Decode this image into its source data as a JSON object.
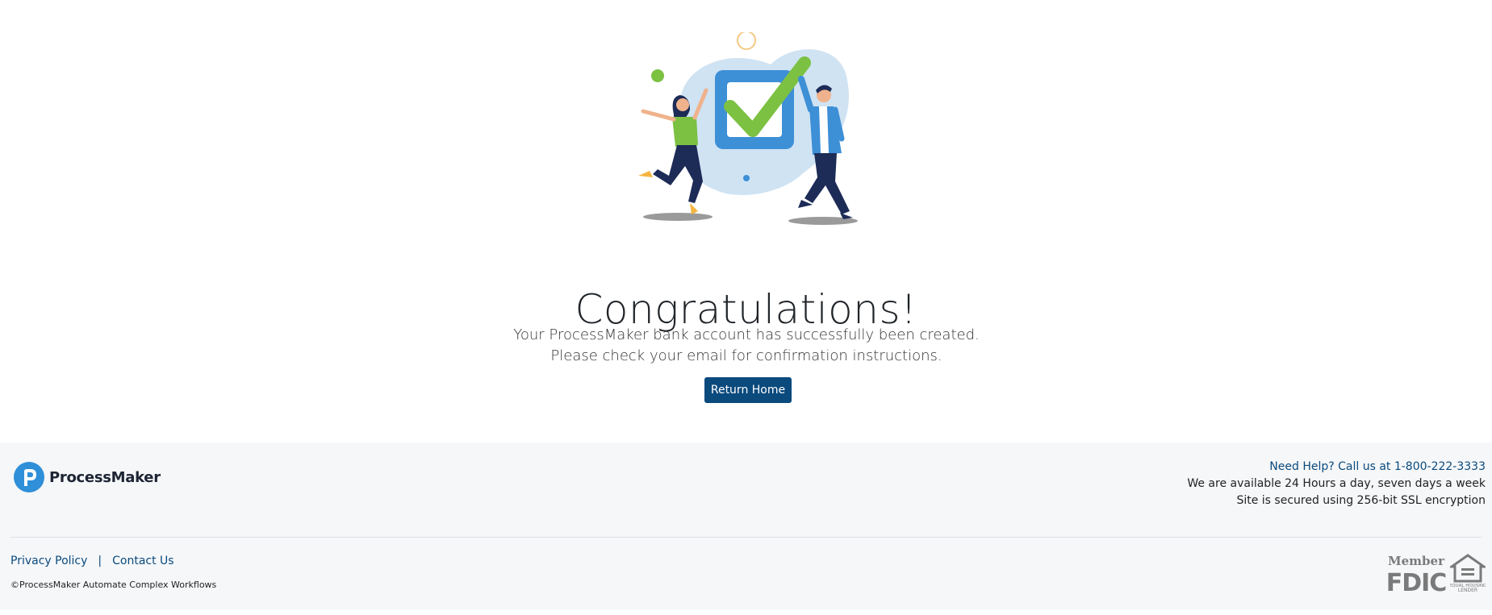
{
  "main": {
    "title": "Congratulations!",
    "message": "Your ProcessMaker bank account has successfully been created. Please check your email for confirmation instructions.",
    "return_button": "Return Home"
  },
  "footer": {
    "brand_name": "ProcessMaker",
    "help_line": "Need Help? Call us at 1-800-222-3333",
    "availability": "We are available 24 Hours a day, seven days a week",
    "security": "Site is secured using 256-bit SSL encryption",
    "links": {
      "privacy": "Privacy Policy",
      "separator": "|",
      "contact": "Contact Us"
    },
    "copyright": "©ProcessMaker Automate Complex Workflows",
    "badges": {
      "fdic_member": "Member",
      "fdic": "FDIC",
      "housing_line1": "EQUAL HOUSING",
      "housing_line2": "LENDER"
    }
  },
  "colors": {
    "primary": "#0b4a7d",
    "check_green": "#7cc142",
    "box_blue": "#3d8fd6",
    "blob": "#cfe3f3",
    "footer_bg": "#f5f7f9"
  }
}
